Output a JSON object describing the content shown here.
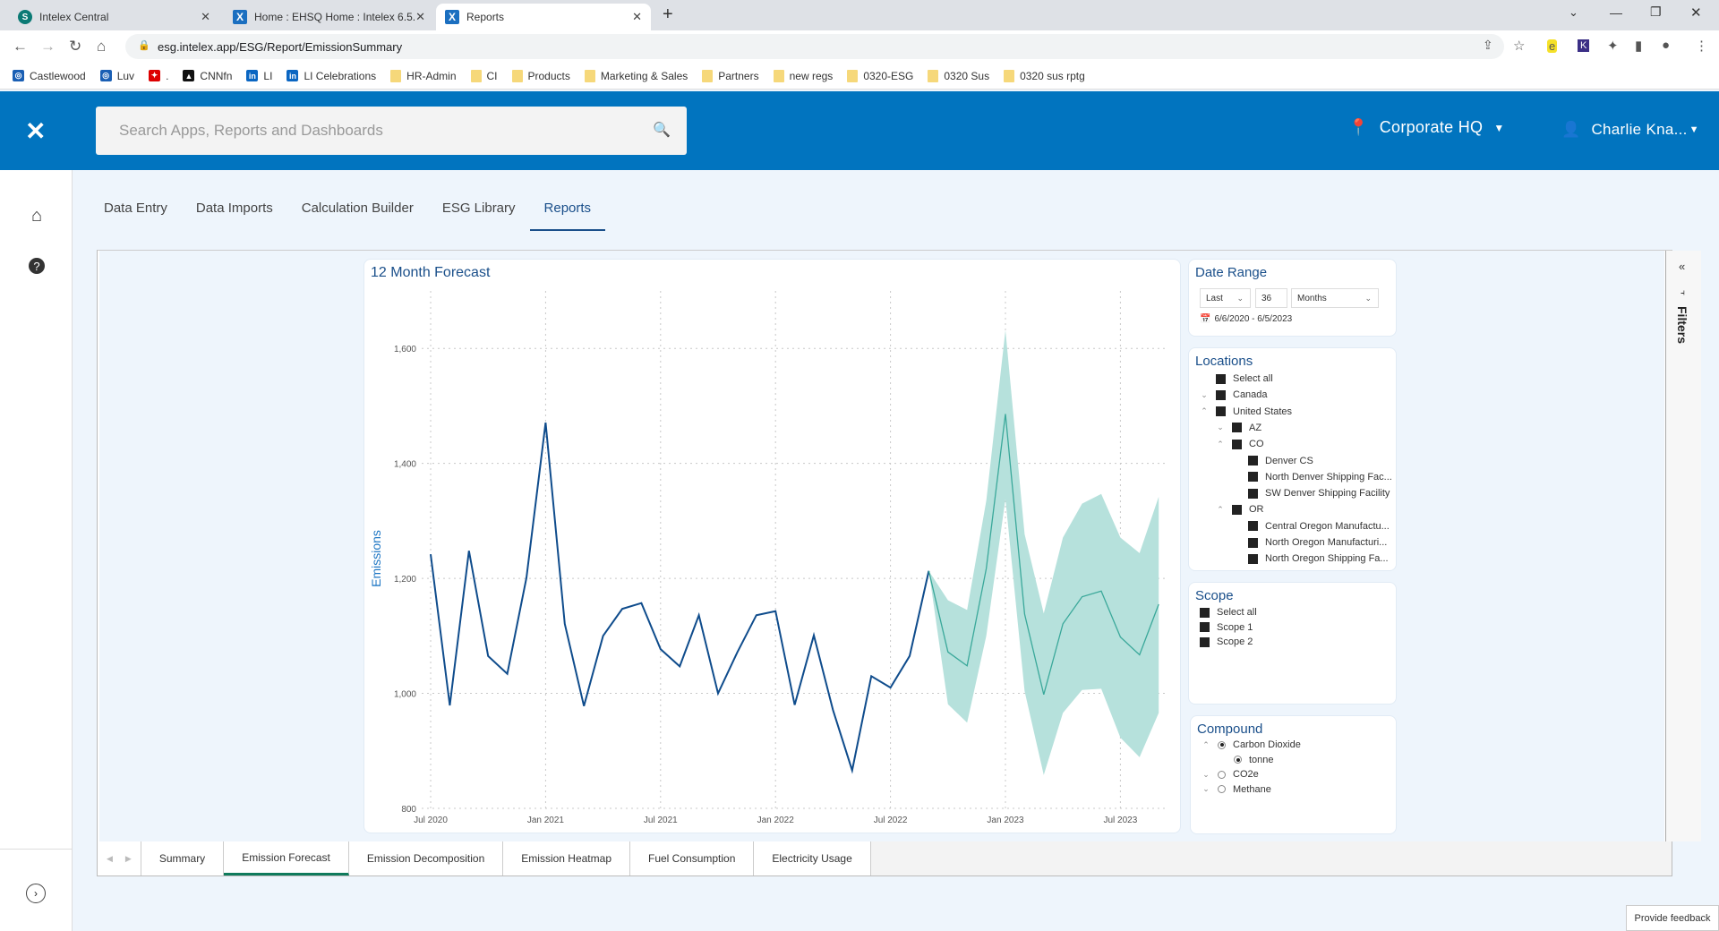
{
  "browser": {
    "tabs": [
      {
        "title": "Intelex Central",
        "icon": "sharepoint-icon"
      },
      {
        "title": "Home : EHSQ Home : Intelex 6.5.",
        "icon": "intelex-icon"
      },
      {
        "title": "Reports",
        "icon": "intelex-icon",
        "active": true
      }
    ],
    "new_tab": "+",
    "url": "esg.intelex.app/ESG/Report/EmissionSummary",
    "bookmarks": [
      {
        "label": "Castlewood",
        "icon": "noaa-icon"
      },
      {
        "label": "Luv",
        "icon": "noaa-icon"
      },
      {
        "label": ".",
        "icon": "maple-leaf-icon"
      },
      {
        "label": "CNNfn",
        "icon": "cnn-icon"
      },
      {
        "label": "LI",
        "icon": "linkedin-icon"
      },
      {
        "label": "LI Celebrations",
        "icon": "linkedin-icon"
      },
      {
        "label": "HR-Admin",
        "icon": "folder-icon"
      },
      {
        "label": "CI",
        "icon": "folder-icon"
      },
      {
        "label": "Products",
        "icon": "folder-icon"
      },
      {
        "label": "Marketing & Sales",
        "icon": "folder-icon"
      },
      {
        "label": "Partners",
        "icon": "folder-icon"
      },
      {
        "label": "new regs",
        "icon": "folder-icon"
      },
      {
        "label": "0320-ESG",
        "icon": "folder-icon"
      },
      {
        "label": "0320 Sus",
        "icon": "folder-icon"
      },
      {
        "label": "0320 sus rptg",
        "icon": "folder-icon"
      }
    ]
  },
  "header": {
    "search_placeholder": "Search Apps, Reports and Dashboards",
    "location": "Corporate HQ",
    "user": "Charlie Kna...",
    "brand_color": "#0174bf"
  },
  "nav": {
    "tabs": [
      "Data Entry",
      "Data Imports",
      "Calculation Builder",
      "ESG Library",
      "Reports"
    ],
    "active": "Reports"
  },
  "report": {
    "chart_title": "12 Month Forecast",
    "date_range": {
      "title": "Date Range",
      "mode": "Last",
      "count": "36",
      "unit": "Months",
      "range_text": "6/6/2020 - 6/5/2023"
    },
    "locations": {
      "title": "Locations",
      "items": [
        {
          "label": "Select all",
          "level": 0,
          "exp": ""
        },
        {
          "label": "Canada",
          "level": 0,
          "exp": "down"
        },
        {
          "label": "United States",
          "level": 0,
          "exp": "up"
        },
        {
          "label": "AZ",
          "level": 1,
          "exp": "down"
        },
        {
          "label": "CO",
          "level": 1,
          "exp": "up"
        },
        {
          "label": "Denver CS",
          "level": 2,
          "exp": ""
        },
        {
          "label": "North Denver Shipping Fac...",
          "level": 2,
          "exp": ""
        },
        {
          "label": "SW Denver Shipping Facility",
          "level": 2,
          "exp": ""
        },
        {
          "label": "OR",
          "level": 1,
          "exp": "up"
        },
        {
          "label": "Central Oregon Manufactu...",
          "level": 2,
          "exp": ""
        },
        {
          "label": "North Oregon Manufacturi...",
          "level": 2,
          "exp": ""
        },
        {
          "label": "North Oregon Shipping Fa...",
          "level": 2,
          "exp": ""
        }
      ]
    },
    "scope": {
      "title": "Scope",
      "items": [
        "Select all",
        "Scope 1",
        "Scope 2"
      ]
    },
    "compound": {
      "title": "Compound",
      "items": [
        {
          "label": "Carbon Dioxide",
          "level": 0,
          "exp": "up",
          "selected": true
        },
        {
          "label": "tonne",
          "level": 1,
          "exp": "",
          "selected": true
        },
        {
          "label": "CO2e",
          "level": 0,
          "exp": "down",
          "selected": false
        },
        {
          "label": "Methane",
          "level": 0,
          "exp": "down",
          "selected": false
        }
      ]
    },
    "filters_label": "Filters",
    "pages": [
      "Summary",
      "Emission Forecast",
      "Emission Decomposition",
      "Emission Heatmap",
      "Fuel Consumption",
      "Electricity Usage"
    ],
    "active_page": "Emission Forecast"
  },
  "feedback": "Provide feedback",
  "chart_data": {
    "type": "line",
    "title": "12 Month Forecast",
    "ylabel": "Emissions",
    "xlabel": "",
    "ylim": [
      800,
      1700
    ],
    "yticks": [
      "800",
      "1,000",
      "1,200",
      "1,400",
      "1,600"
    ],
    "ytick_values": [
      800,
      1000,
      1200,
      1400,
      1600
    ],
    "xticks": [
      "Jul 2020",
      "Jan 2021",
      "Jul 2021",
      "Jan 2022",
      "Jul 2022",
      "Jan 2023",
      "Jul 2023"
    ],
    "xtick_values": [
      "2020-07",
      "2021-01",
      "2021-07",
      "2022-01",
      "2022-07",
      "2023-01",
      "2023-07"
    ],
    "grid": true,
    "colors": {
      "actual": "#0f4c8c",
      "forecast": "#3aa89a",
      "band": "#b6e1dc"
    },
    "actual": {
      "x": [
        "2020-07",
        "2020-08",
        "2020-09",
        "2020-10",
        "2020-11",
        "2020-12",
        "2021-01",
        "2021-02",
        "2021-03",
        "2021-04",
        "2021-05",
        "2021-06",
        "2021-07",
        "2021-08",
        "2021-09",
        "2021-10",
        "2021-11",
        "2021-12",
        "2022-01",
        "2022-02",
        "2022-03",
        "2022-04",
        "2022-05",
        "2022-06",
        "2022-07",
        "2022-08",
        "2022-09"
      ],
      "y": [
        1242,
        979,
        1248,
        1065,
        1034,
        1201,
        1471,
        1121,
        978,
        1100,
        1147,
        1157,
        1077,
        1047,
        1136,
        1000,
        1071,
        1136,
        1143,
        980,
        1101,
        971,
        866,
        1030,
        1010,
        1065,
        1213
      ]
    },
    "forecast": {
      "x": [
        "2022-10",
        "2022-11",
        "2022-12",
        "2023-01",
        "2023-02",
        "2023-03",
        "2023-04",
        "2023-05",
        "2023-06",
        "2023-07",
        "2023-08",
        "2023-09"
      ],
      "y": [
        1072,
        1048,
        1217,
        1486,
        1138,
        998,
        1121,
        1168,
        1178,
        1098,
        1067,
        1155
      ],
      "upper": [
        1162,
        1145,
        1335,
        1632,
        1277,
        1139,
        1271,
        1330,
        1347,
        1271,
        1244,
        1342
      ],
      "lower": [
        981,
        949,
        1100,
        1338,
        1004,
        858,
        966,
        1006,
        1008,
        923,
        889,
        966
      ]
    }
  }
}
